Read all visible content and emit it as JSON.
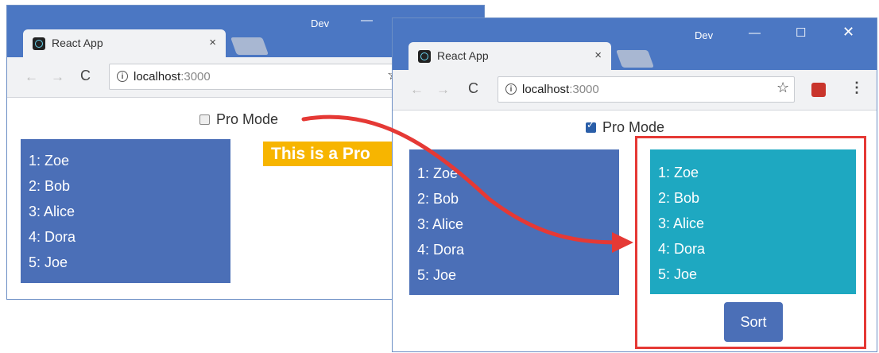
{
  "colors": {
    "titlebar": "#4b77c3",
    "list_background_blue": "#4b6fb7",
    "list_background_teal": "#1ea8c1",
    "banner": "#f7b500",
    "highlight_frame": "#e53935",
    "arrow": "#e53935"
  },
  "left_window": {
    "tab_title": "React App",
    "tab_close": "×",
    "profile_label": "Dev",
    "url_host": "localhost",
    "url_port": ":3000",
    "pro_mode_label": "Pro Mode",
    "pro_mode_checked": false,
    "banner_text": "This is a Pro",
    "names": [
      "1: Zoe",
      "2: Bob",
      "3: Alice",
      "4: Dora",
      "5: Joe"
    ]
  },
  "right_window": {
    "tab_title": "React App",
    "tab_close": "×",
    "profile_label": "Dev",
    "url_host": "localhost",
    "url_port": ":3000",
    "pro_mode_label": "Pro Mode",
    "pro_mode_checked": true,
    "names": [
      "1: Zoe",
      "2: Bob",
      "3: Alice",
      "4: Dora",
      "5: Joe"
    ],
    "pro_names": [
      "1: Zoe",
      "2: Bob",
      "3: Alice",
      "4: Dora",
      "5: Joe"
    ],
    "sort_label": "Sort"
  },
  "icons": {
    "back": "back-arrow-icon",
    "forward": "forward-arrow-icon",
    "reload": "reload-icon",
    "info": "info-icon",
    "star": "star-icon",
    "extension": "extension-icon",
    "menu": "menu-dots-icon",
    "minimize": "minimize-icon",
    "maximize": "maximize-icon",
    "close": "close-icon"
  }
}
